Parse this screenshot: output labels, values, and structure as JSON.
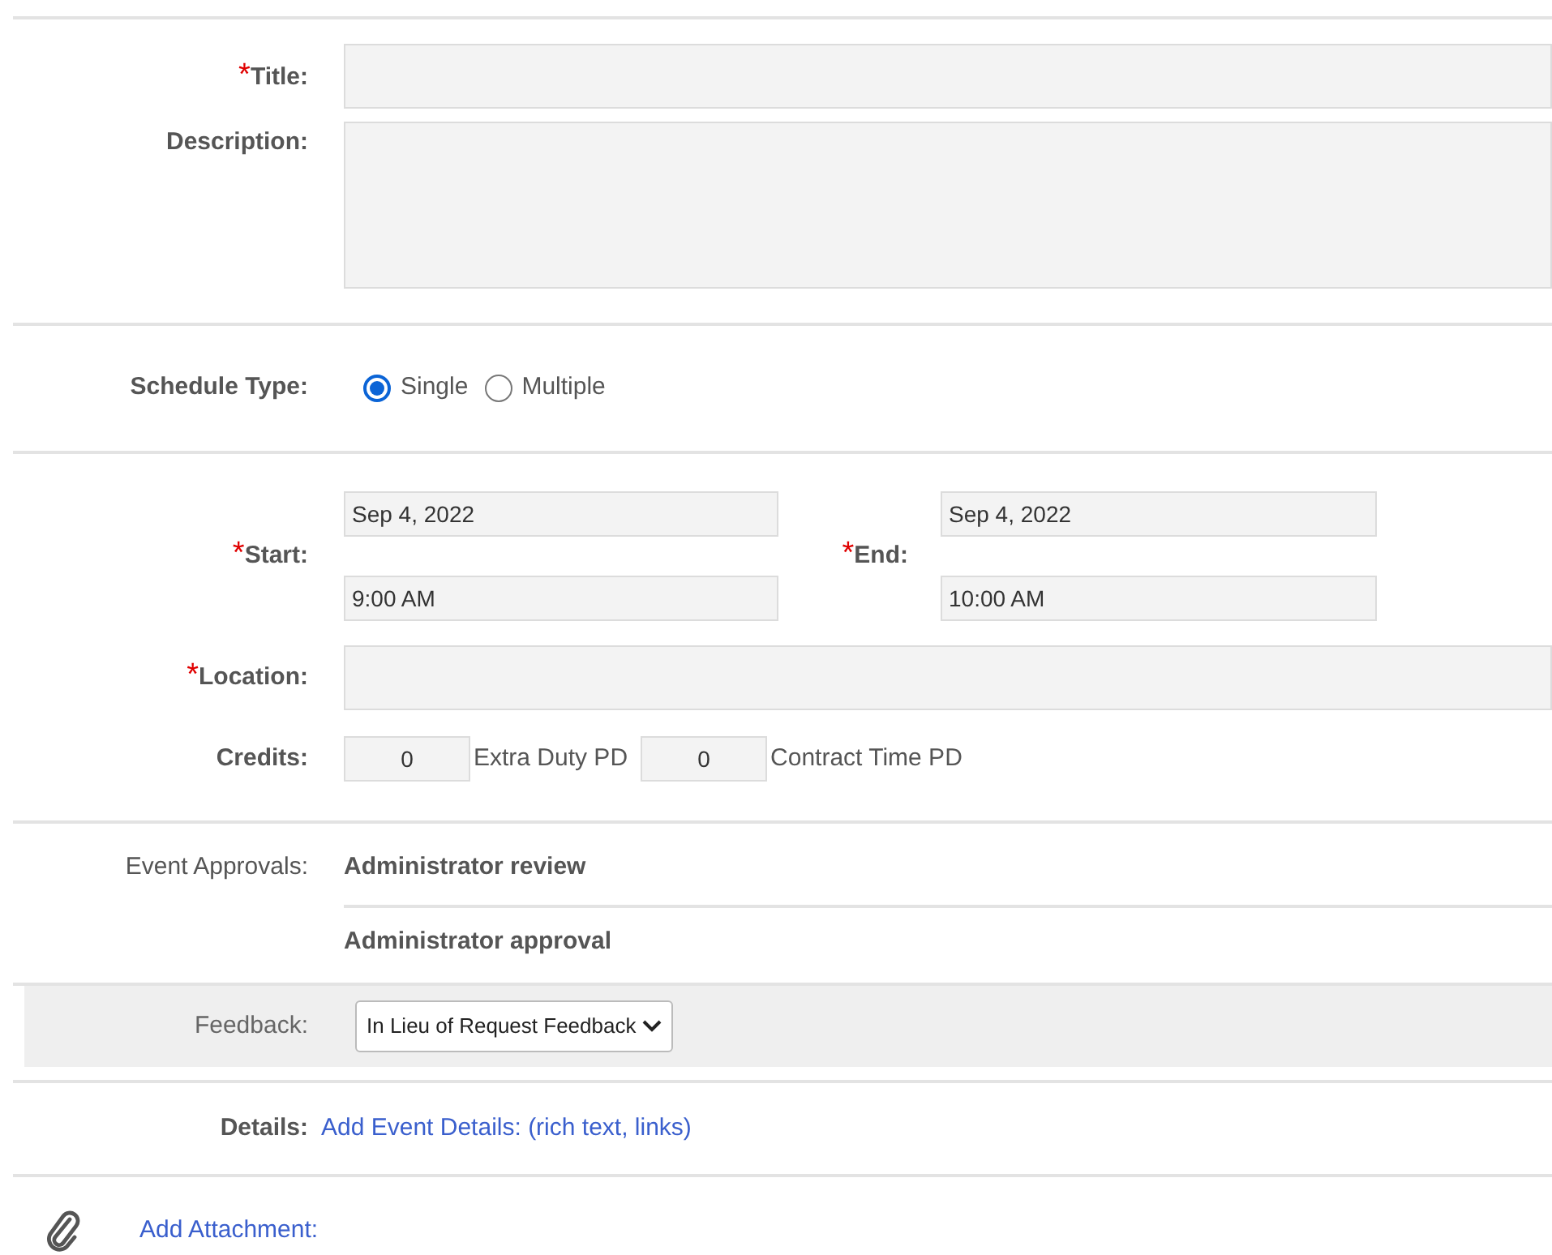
{
  "title": {
    "label": "Title:",
    "required_mark": "*"
  },
  "description": {
    "label": "Description:"
  },
  "schedule_type": {
    "label": "Schedule Type:",
    "options": [
      {
        "label": "Single",
        "selected": true
      },
      {
        "label": "Multiple",
        "selected": false
      }
    ]
  },
  "start": {
    "label": "Start:",
    "required_mark": "*",
    "date": "Sep 4, 2022",
    "time": "9:00 AM"
  },
  "end": {
    "label": "End:",
    "required_mark": "*",
    "date": "Sep 4, 2022",
    "time": "10:00 AM"
  },
  "location": {
    "label": "Location:",
    "required_mark": "*"
  },
  "credits": {
    "label": "Credits:",
    "items": [
      {
        "value": "0",
        "unit": "Extra Duty PD"
      },
      {
        "value": "0",
        "unit": "Contract Time PD"
      }
    ]
  },
  "event_approvals": {
    "label": "Event Approvals:",
    "items": [
      "Administrator review",
      "Administrator approval"
    ]
  },
  "feedback": {
    "label": "Feedback:",
    "value": "In Lieu of Request Feedback"
  },
  "details": {
    "label": "Details:",
    "link": "Add Event Details: (rich text, links)"
  },
  "attachment": {
    "link": "Add Attachment:"
  }
}
